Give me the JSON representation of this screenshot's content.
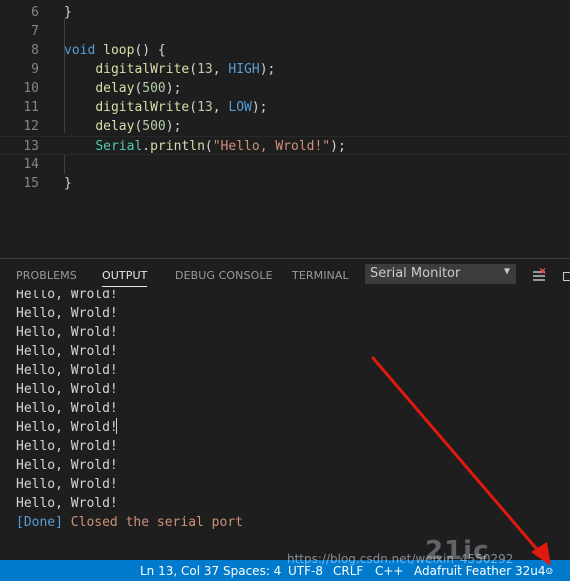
{
  "editor": {
    "lines": [
      {
        "num": "6",
        "tokens": [
          {
            "t": "}",
            "c": "pl"
          }
        ]
      },
      {
        "num": "7",
        "tokens": []
      },
      {
        "num": "8",
        "tokens": [
          {
            "t": "void",
            "c": "kw"
          },
          {
            "t": " ",
            "c": "pl"
          },
          {
            "t": "loop",
            "c": "fn"
          },
          {
            "t": "() {",
            "c": "pl"
          }
        ]
      },
      {
        "num": "9",
        "tokens": [
          {
            "t": "    ",
            "c": "pl"
          },
          {
            "t": "digitalWrite",
            "c": "fn"
          },
          {
            "t": "(",
            "c": "pl"
          },
          {
            "t": "13",
            "c": "num"
          },
          {
            "t": ", ",
            "c": "pl"
          },
          {
            "t": "HIGH",
            "c": "kw"
          },
          {
            "t": ");",
            "c": "pl"
          }
        ]
      },
      {
        "num": "10",
        "tokens": [
          {
            "t": "    ",
            "c": "pl"
          },
          {
            "t": "delay",
            "c": "fn"
          },
          {
            "t": "(",
            "c": "pl"
          },
          {
            "t": "500",
            "c": "num"
          },
          {
            "t": ");",
            "c": "pl"
          }
        ]
      },
      {
        "num": "11",
        "tokens": [
          {
            "t": "    ",
            "c": "pl"
          },
          {
            "t": "digitalWrite",
            "c": "fn"
          },
          {
            "t": "(",
            "c": "pl"
          },
          {
            "t": "13",
            "c": "num"
          },
          {
            "t": ", ",
            "c": "pl"
          },
          {
            "t": "LOW",
            "c": "kw"
          },
          {
            "t": ");",
            "c": "pl"
          }
        ]
      },
      {
        "num": "12",
        "tokens": [
          {
            "t": "    ",
            "c": "pl"
          },
          {
            "t": "delay",
            "c": "fn"
          },
          {
            "t": "(",
            "c": "pl"
          },
          {
            "t": "500",
            "c": "num"
          },
          {
            "t": ");",
            "c": "pl"
          }
        ]
      },
      {
        "num": "13",
        "active": true,
        "tokens": [
          {
            "t": "    ",
            "c": "pl"
          },
          {
            "t": "Serial",
            "c": "cls"
          },
          {
            "t": ".",
            "c": "pl"
          },
          {
            "t": "println",
            "c": "fn"
          },
          {
            "t": "(",
            "c": "pl"
          },
          {
            "t": "\"Hello, Wrold!\"",
            "c": "str"
          },
          {
            "t": ");",
            "c": "pl"
          }
        ]
      },
      {
        "num": "14",
        "tokens": []
      },
      {
        "num": "15",
        "tokens": [
          {
            "t": "}",
            "c": "pl"
          }
        ]
      }
    ]
  },
  "panel": {
    "tabs": [
      {
        "label": "PROBLEMS",
        "active": false
      },
      {
        "label": "OUTPUT",
        "active": true
      },
      {
        "label": "DEBUG CONSOLE",
        "active": false
      },
      {
        "label": "TERMINAL",
        "active": false
      }
    ],
    "channel_selected": "Serial Monitor",
    "dropdown_arrow": "▼"
  },
  "output": {
    "lines": [
      "Hello, Wrold!",
      "Hello, Wrold!",
      "Hello, Wrold!",
      "Hello, Wrold!",
      "Hello, Wrold!",
      "Hello, Wrold!",
      "Hello, Wrold!",
      "Hello, Wrold!",
      "Hello, Wrold!",
      "Hello, Wrold!",
      "Hello, Wrold!",
      "Hello, Wrold!"
    ],
    "final_tag": "[Done]",
    "final_text": "Closed the serial port"
  },
  "status_bar": {
    "position": "Ln 13, Col 37",
    "spaces": "Spaces: 4",
    "encoding": "UTF-8",
    "eol": "CRLF",
    "language": "C++",
    "board": "Adafruit Feather 32u4"
  },
  "watermark": {
    "text": "https://blog.csdn.net/weixin_4550292",
    "logo": "21ic"
  },
  "colors": {
    "accent": "#007acc",
    "editor_bg": "#1e1e1e",
    "arrow": "#e0190f"
  },
  "icons": [
    "clear-output-icon",
    "maximize-panel-icon",
    "feedback-icon",
    "red-annotation-arrow"
  ]
}
